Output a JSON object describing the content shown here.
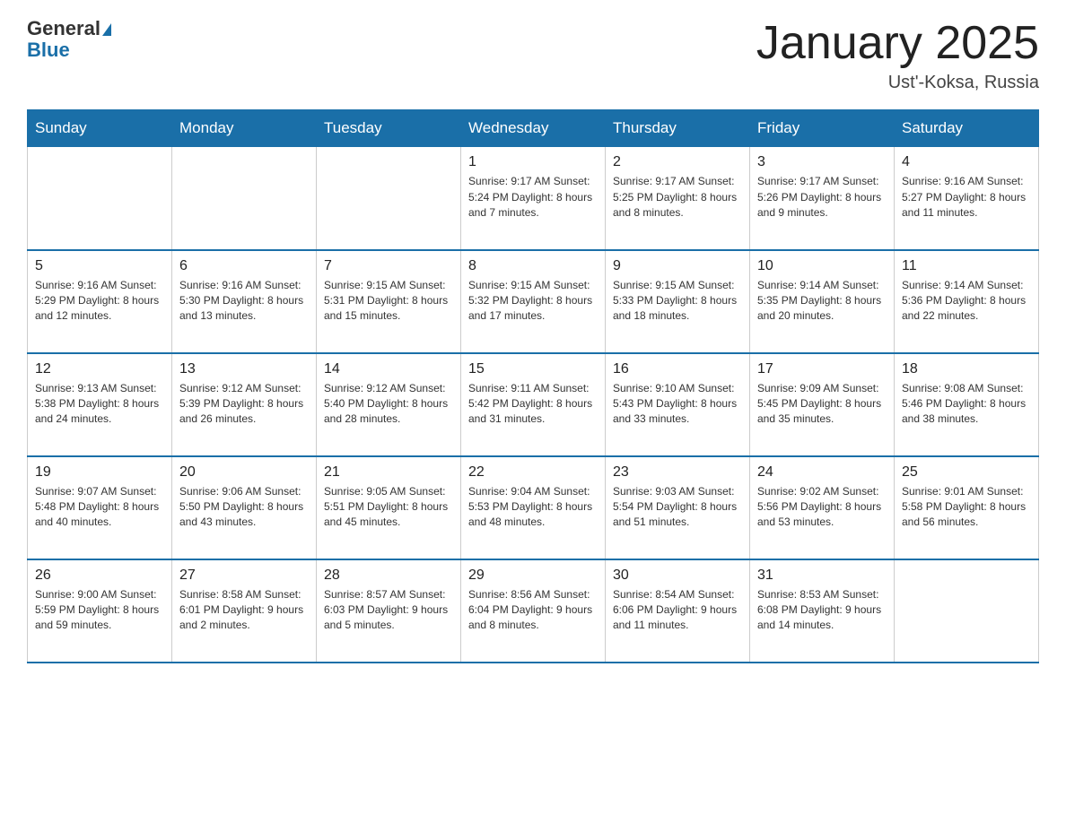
{
  "header": {
    "logo_line1": "General",
    "logo_line2": "Blue",
    "month": "January 2025",
    "location": "Ust'-Koksa, Russia"
  },
  "weekdays": [
    "Sunday",
    "Monday",
    "Tuesday",
    "Wednesday",
    "Thursday",
    "Friday",
    "Saturday"
  ],
  "weeks": [
    [
      {
        "day": "",
        "info": ""
      },
      {
        "day": "",
        "info": ""
      },
      {
        "day": "",
        "info": ""
      },
      {
        "day": "1",
        "info": "Sunrise: 9:17 AM\nSunset: 5:24 PM\nDaylight: 8 hours\nand 7 minutes."
      },
      {
        "day": "2",
        "info": "Sunrise: 9:17 AM\nSunset: 5:25 PM\nDaylight: 8 hours\nand 8 minutes."
      },
      {
        "day": "3",
        "info": "Sunrise: 9:17 AM\nSunset: 5:26 PM\nDaylight: 8 hours\nand 9 minutes."
      },
      {
        "day": "4",
        "info": "Sunrise: 9:16 AM\nSunset: 5:27 PM\nDaylight: 8 hours\nand 11 minutes."
      }
    ],
    [
      {
        "day": "5",
        "info": "Sunrise: 9:16 AM\nSunset: 5:29 PM\nDaylight: 8 hours\nand 12 minutes."
      },
      {
        "day": "6",
        "info": "Sunrise: 9:16 AM\nSunset: 5:30 PM\nDaylight: 8 hours\nand 13 minutes."
      },
      {
        "day": "7",
        "info": "Sunrise: 9:15 AM\nSunset: 5:31 PM\nDaylight: 8 hours\nand 15 minutes."
      },
      {
        "day": "8",
        "info": "Sunrise: 9:15 AM\nSunset: 5:32 PM\nDaylight: 8 hours\nand 17 minutes."
      },
      {
        "day": "9",
        "info": "Sunrise: 9:15 AM\nSunset: 5:33 PM\nDaylight: 8 hours\nand 18 minutes."
      },
      {
        "day": "10",
        "info": "Sunrise: 9:14 AM\nSunset: 5:35 PM\nDaylight: 8 hours\nand 20 minutes."
      },
      {
        "day": "11",
        "info": "Sunrise: 9:14 AM\nSunset: 5:36 PM\nDaylight: 8 hours\nand 22 minutes."
      }
    ],
    [
      {
        "day": "12",
        "info": "Sunrise: 9:13 AM\nSunset: 5:38 PM\nDaylight: 8 hours\nand 24 minutes."
      },
      {
        "day": "13",
        "info": "Sunrise: 9:12 AM\nSunset: 5:39 PM\nDaylight: 8 hours\nand 26 minutes."
      },
      {
        "day": "14",
        "info": "Sunrise: 9:12 AM\nSunset: 5:40 PM\nDaylight: 8 hours\nand 28 minutes."
      },
      {
        "day": "15",
        "info": "Sunrise: 9:11 AM\nSunset: 5:42 PM\nDaylight: 8 hours\nand 31 minutes."
      },
      {
        "day": "16",
        "info": "Sunrise: 9:10 AM\nSunset: 5:43 PM\nDaylight: 8 hours\nand 33 minutes."
      },
      {
        "day": "17",
        "info": "Sunrise: 9:09 AM\nSunset: 5:45 PM\nDaylight: 8 hours\nand 35 minutes."
      },
      {
        "day": "18",
        "info": "Sunrise: 9:08 AM\nSunset: 5:46 PM\nDaylight: 8 hours\nand 38 minutes."
      }
    ],
    [
      {
        "day": "19",
        "info": "Sunrise: 9:07 AM\nSunset: 5:48 PM\nDaylight: 8 hours\nand 40 minutes."
      },
      {
        "day": "20",
        "info": "Sunrise: 9:06 AM\nSunset: 5:50 PM\nDaylight: 8 hours\nand 43 minutes."
      },
      {
        "day": "21",
        "info": "Sunrise: 9:05 AM\nSunset: 5:51 PM\nDaylight: 8 hours\nand 45 minutes."
      },
      {
        "day": "22",
        "info": "Sunrise: 9:04 AM\nSunset: 5:53 PM\nDaylight: 8 hours\nand 48 minutes."
      },
      {
        "day": "23",
        "info": "Sunrise: 9:03 AM\nSunset: 5:54 PM\nDaylight: 8 hours\nand 51 minutes."
      },
      {
        "day": "24",
        "info": "Sunrise: 9:02 AM\nSunset: 5:56 PM\nDaylight: 8 hours\nand 53 minutes."
      },
      {
        "day": "25",
        "info": "Sunrise: 9:01 AM\nSunset: 5:58 PM\nDaylight: 8 hours\nand 56 minutes."
      }
    ],
    [
      {
        "day": "26",
        "info": "Sunrise: 9:00 AM\nSunset: 5:59 PM\nDaylight: 8 hours\nand 59 minutes."
      },
      {
        "day": "27",
        "info": "Sunrise: 8:58 AM\nSunset: 6:01 PM\nDaylight: 9 hours\nand 2 minutes."
      },
      {
        "day": "28",
        "info": "Sunrise: 8:57 AM\nSunset: 6:03 PM\nDaylight: 9 hours\nand 5 minutes."
      },
      {
        "day": "29",
        "info": "Sunrise: 8:56 AM\nSunset: 6:04 PM\nDaylight: 9 hours\nand 8 minutes."
      },
      {
        "day": "30",
        "info": "Sunrise: 8:54 AM\nSunset: 6:06 PM\nDaylight: 9 hours\nand 11 minutes."
      },
      {
        "day": "31",
        "info": "Sunrise: 8:53 AM\nSunset: 6:08 PM\nDaylight: 9 hours\nand 14 minutes."
      },
      {
        "day": "",
        "info": ""
      }
    ]
  ]
}
